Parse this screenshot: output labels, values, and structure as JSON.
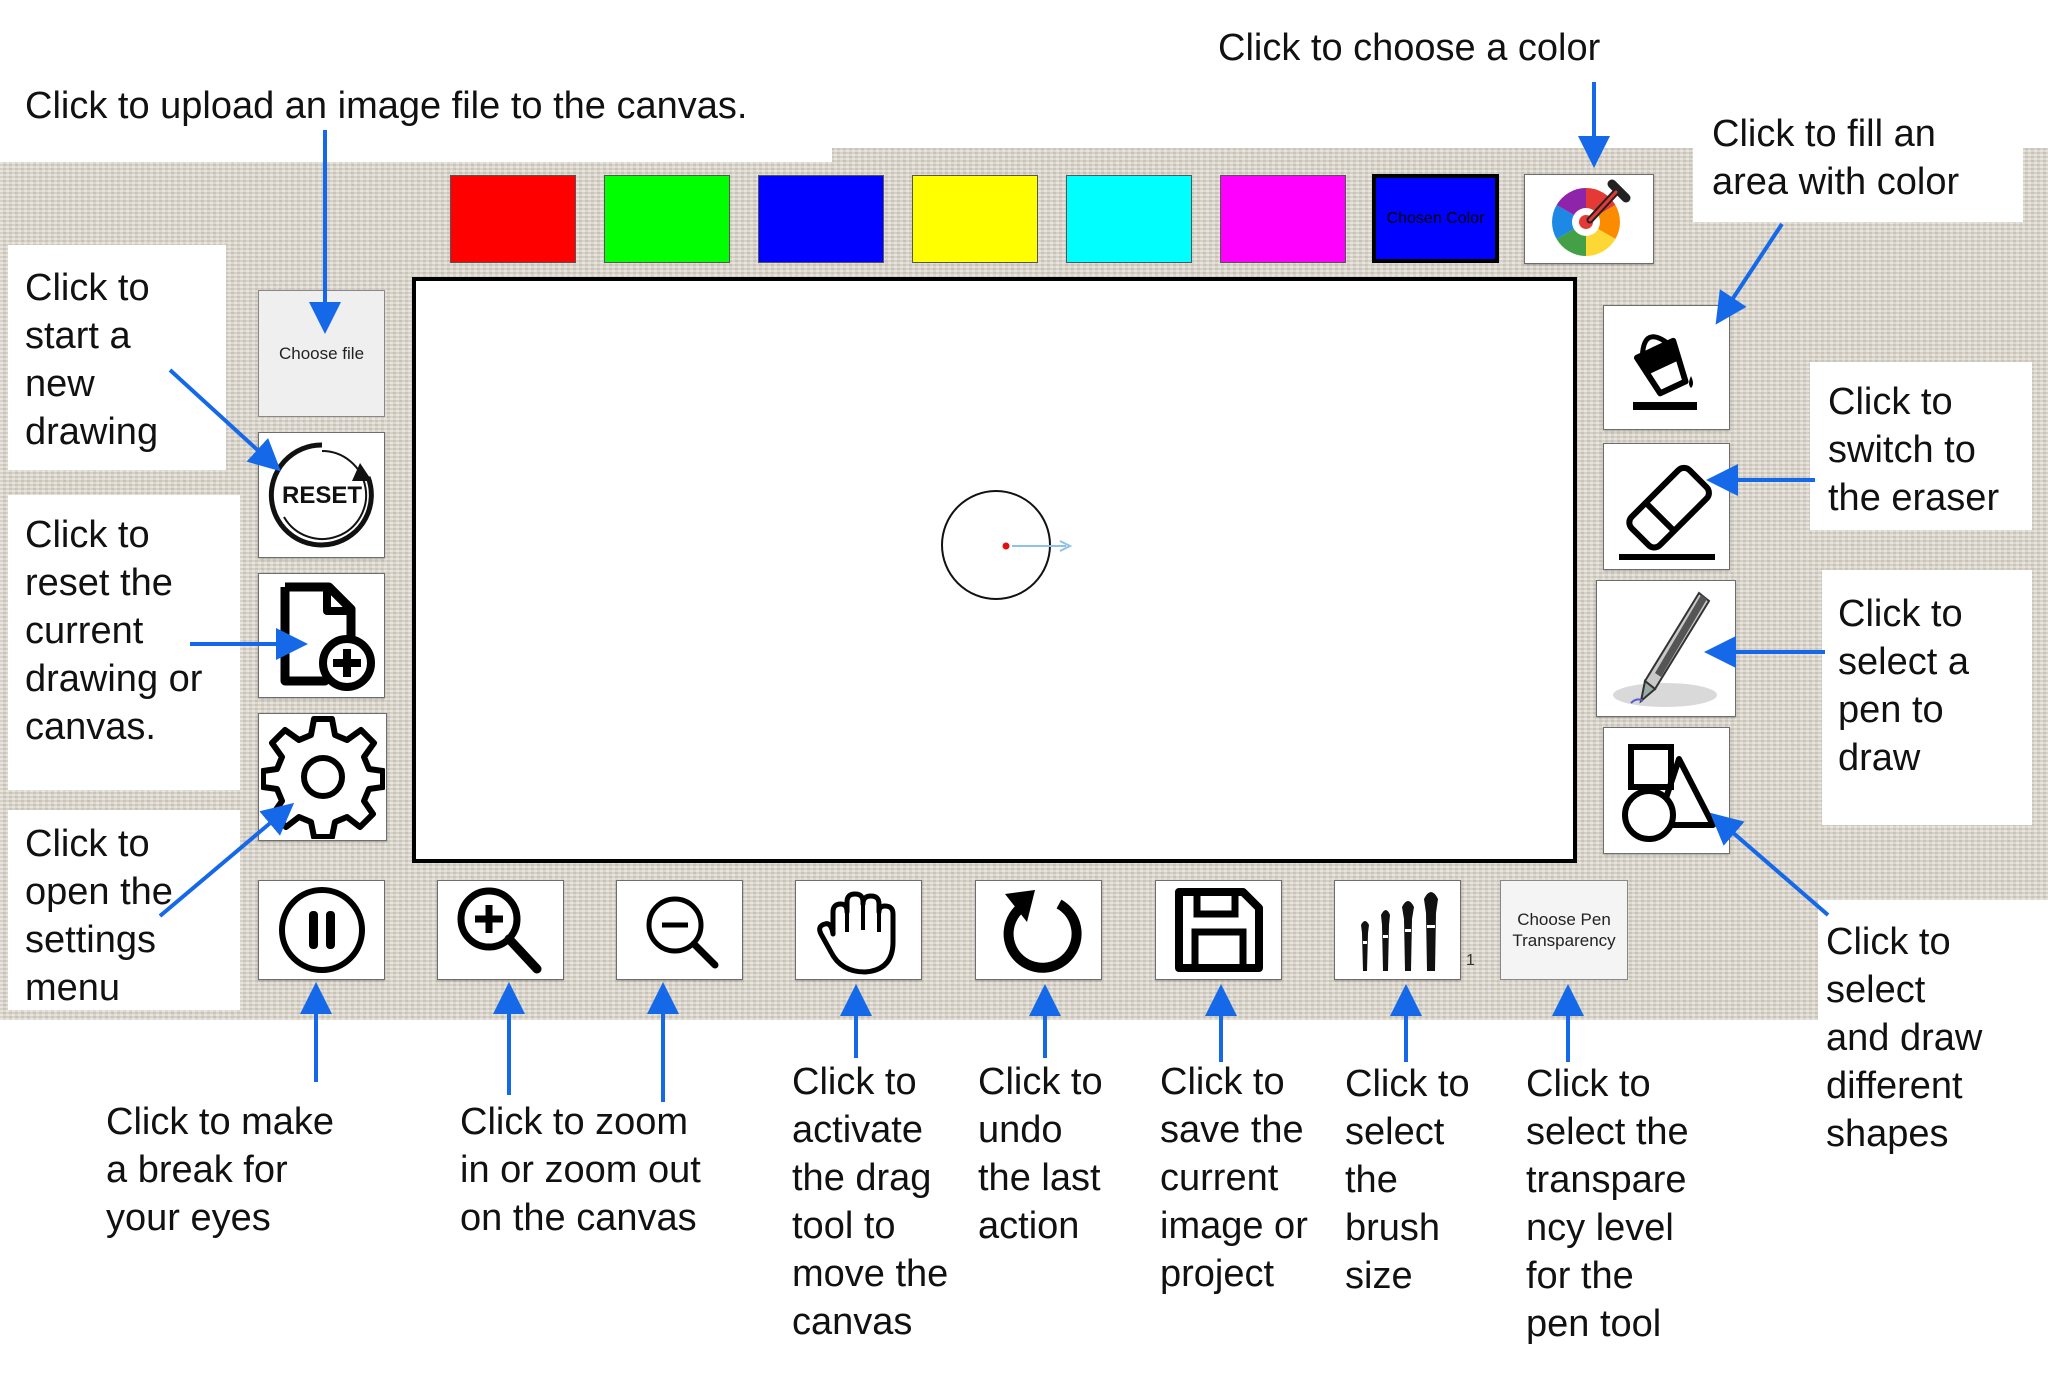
{
  "annotations": {
    "upload": "Click to upload an image file to the canvas.",
    "choose_color": "Click to choose a color",
    "fill": "Click to fill an\narea with color",
    "new_drawing": "Click to\nstart a\nnew\ndrawing",
    "reset": "Click to\nreset the\ncurrent\ndrawing or\ncanvas.",
    "settings": "Click to\nopen the\nsettings\nmenu",
    "eraser": "Click to\nswitch to\nthe eraser",
    "pen": "Click to\nselect a\npen to\ndraw",
    "shapes": "Click to\nselect\nand draw\ndifferent\nshapes",
    "break": "Click to make\na break for\nyour eyes",
    "zoom": "Click to zoom\nin or zoom out\non the canvas",
    "drag": "Click to\nactivate\nthe drag\ntool to\nmove the\ncanvas",
    "undo": "Click to\nundo\nthe last\naction",
    "save": "Click to\nsave the\ncurrent\nimage or\nproject",
    "brush": "Click to\nselect\nthe\nbrush\nsize",
    "transparency": "Click to\nselect the\ntranspare\nncy level\nfor the\npen tool"
  },
  "palette": {
    "swatches": [
      {
        "name": "red",
        "color": "#ff0000"
      },
      {
        "name": "green",
        "color": "#00ff00"
      },
      {
        "name": "blue",
        "color": "#0000ff"
      },
      {
        "name": "yellow",
        "color": "#ffff00"
      },
      {
        "name": "cyan",
        "color": "#00ffff"
      },
      {
        "name": "magenta",
        "color": "#ff00ff"
      }
    ],
    "chosen_label": "Chosen Color",
    "chosen_color": "#0000ff",
    "picker_icon": "color-wheel-dropper-icon"
  },
  "toolbar_left": {
    "file_label": "Choose file",
    "reset_label": "RESET",
    "new_icon": "new-document-icon",
    "settings_icon": "gear-icon",
    "pause_icon": "pause-icon"
  },
  "toolbar_right": {
    "fill_icon": "paint-bucket-icon",
    "eraser_icon": "eraser-icon",
    "pen_icon": "pen-icon",
    "shapes_icon": "shapes-icon"
  },
  "toolbar_bottom": {
    "zoom_in_icon": "zoom-in-icon",
    "zoom_out_icon": "zoom-out-icon",
    "drag_icon": "hand-icon",
    "undo_icon": "undo-icon",
    "save_icon": "floppy-disk-icon",
    "brush_icon": "brushes-icon",
    "brush_size": "1",
    "transparency_label": "Choose Pen Transparency"
  },
  "colors": {
    "accent_arrow": "#1569e8",
    "canvas_border": "#000000",
    "cursor_dot": "#e01010"
  }
}
